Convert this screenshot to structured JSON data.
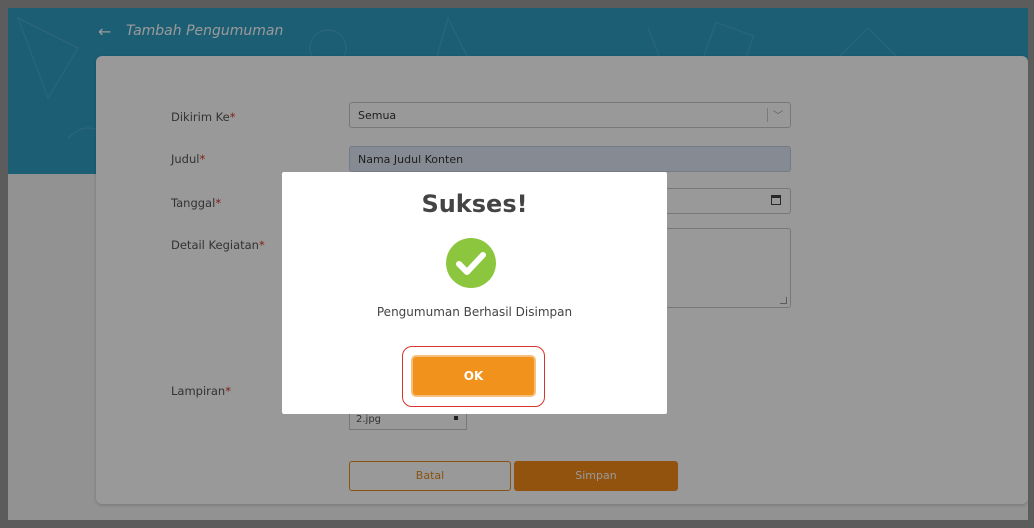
{
  "header": {
    "back_icon": "arrow-left-icon",
    "title": "Tambah Pengumuman"
  },
  "form": {
    "dikirim_ke": {
      "label": "Dikirim Ke",
      "value": "Semua",
      "icon": "chevron-down-icon"
    },
    "judul": {
      "label": "Judul",
      "value": "Nama  Judul Konten"
    },
    "tanggal": {
      "label": "Tanggal",
      "value": "",
      "icon": "calendar-icon"
    },
    "detail": {
      "label": "Detail Kegiatan",
      "value": ""
    },
    "lampiran": {
      "label": "Lampiran",
      "file_name": "2.jpg",
      "remove_icon": "close-icon"
    },
    "required_marker": "*",
    "cancel_label": "Batal",
    "save_label": "Simpan"
  },
  "modal": {
    "title": "Sukses!",
    "icon": "check-circle-icon",
    "message": "Pengumuman Berhasil Disimpan",
    "ok_label": "OK"
  },
  "colors": {
    "banner": "#2f9ec4",
    "accent": "#f28a16",
    "success": "#8cc63f",
    "highlight": "#d9342b"
  }
}
